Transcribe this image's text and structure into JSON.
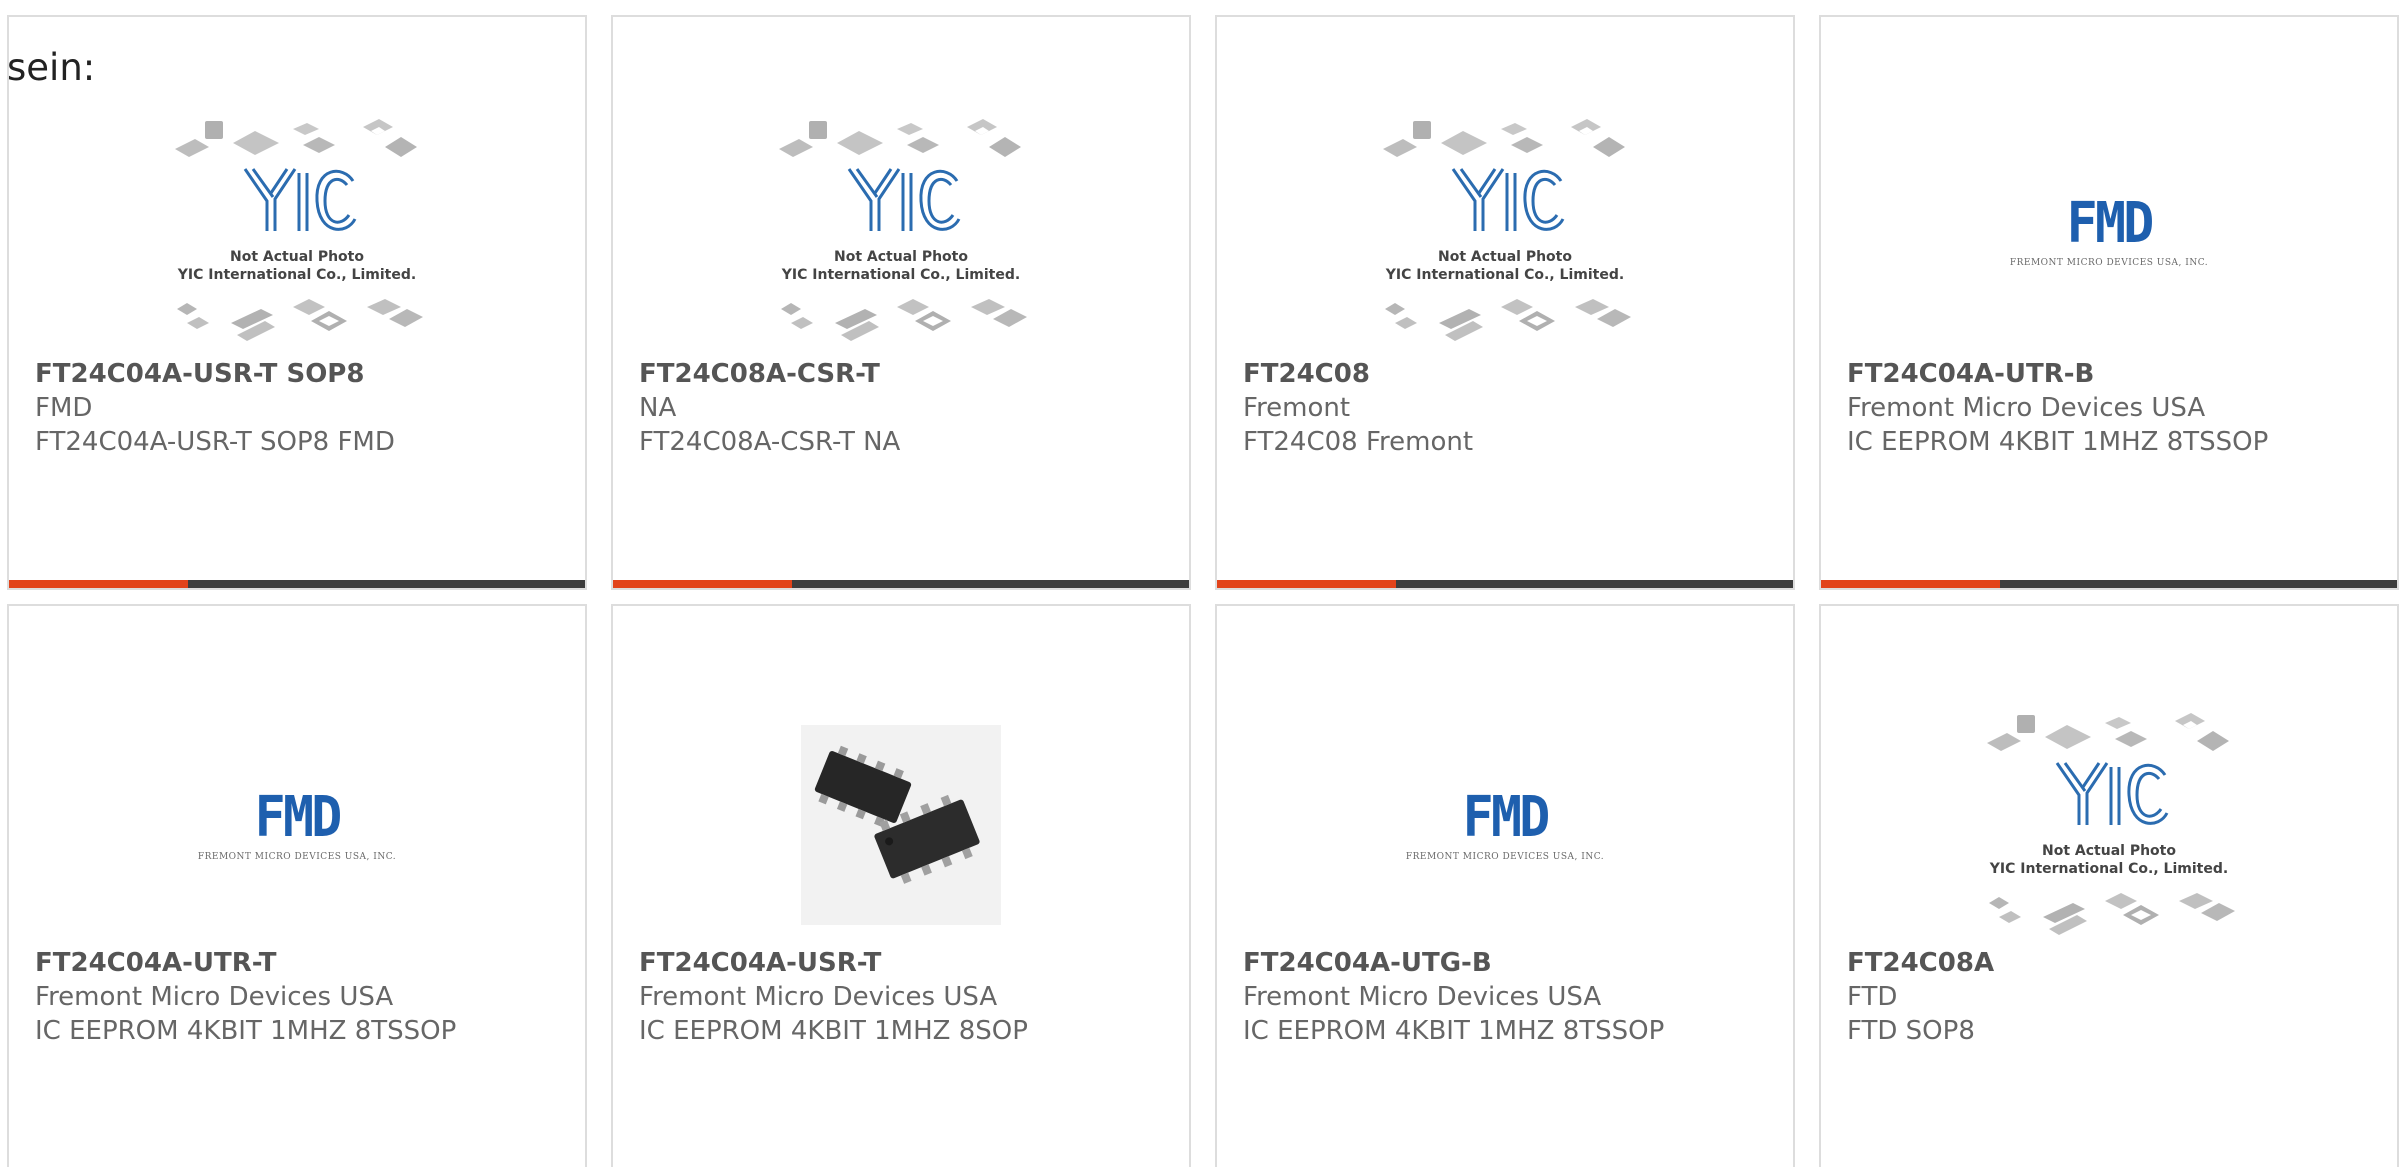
{
  "intro": {
    "text": "sein:"
  },
  "placeholder": {
    "line1": "Not Actual Photo",
    "line2": "YIC International Co., Limited."
  },
  "fmd_logo": {
    "mark": "FMD",
    "subtitle": "FREMONT MICRO DEVICES USA, INC."
  },
  "colors": {
    "accent": "#e2431a",
    "bar_track": "#3d3d3d",
    "fmd_blue": "#1e5fae"
  },
  "products": [
    {
      "part_number": "FT24C04A-USR-T SOP8",
      "manufacturer": "FMD",
      "description": "FT24C04A-USR-T SOP8 FMD",
      "image": "yic-placeholder",
      "progress": 0.31
    },
    {
      "part_number": "FT24C08A-CSR-T",
      "manufacturer": "NA",
      "description": "FT24C08A-CSR-T NA",
      "image": "yic-placeholder",
      "progress": 0.31
    },
    {
      "part_number": "FT24C08",
      "manufacturer": "Fremont",
      "description": "FT24C08 Fremont",
      "image": "yic-placeholder",
      "progress": 0.31
    },
    {
      "part_number": "FT24C04A-UTR-B",
      "manufacturer": "Fremont Micro Devices USA",
      "description": "IC EEPROM 4KBIT 1MHZ 8TSSOP",
      "image": "fmd-logo",
      "progress": 0.31
    },
    {
      "part_number": "FT24C04A-UTR-T",
      "manufacturer": "Fremont Micro Devices USA",
      "description": "IC EEPROM 4KBIT 1MHZ 8TSSOP",
      "image": "fmd-logo"
    },
    {
      "part_number": "FT24C04A-USR-T",
      "manufacturer": "Fremont Micro Devices USA",
      "description": "IC EEPROM 4KBIT 1MHZ 8SOP",
      "image": "sop8-chip-photo"
    },
    {
      "part_number": "FT24C04A-UTG-B",
      "manufacturer": "Fremont Micro Devices USA",
      "description": "IC EEPROM 4KBIT 1MHZ 8TSSOP",
      "image": "fmd-logo"
    },
    {
      "part_number": "FT24C08A",
      "manufacturer": "FTD",
      "description": "FTD SOP8",
      "image": "yic-placeholder"
    }
  ]
}
